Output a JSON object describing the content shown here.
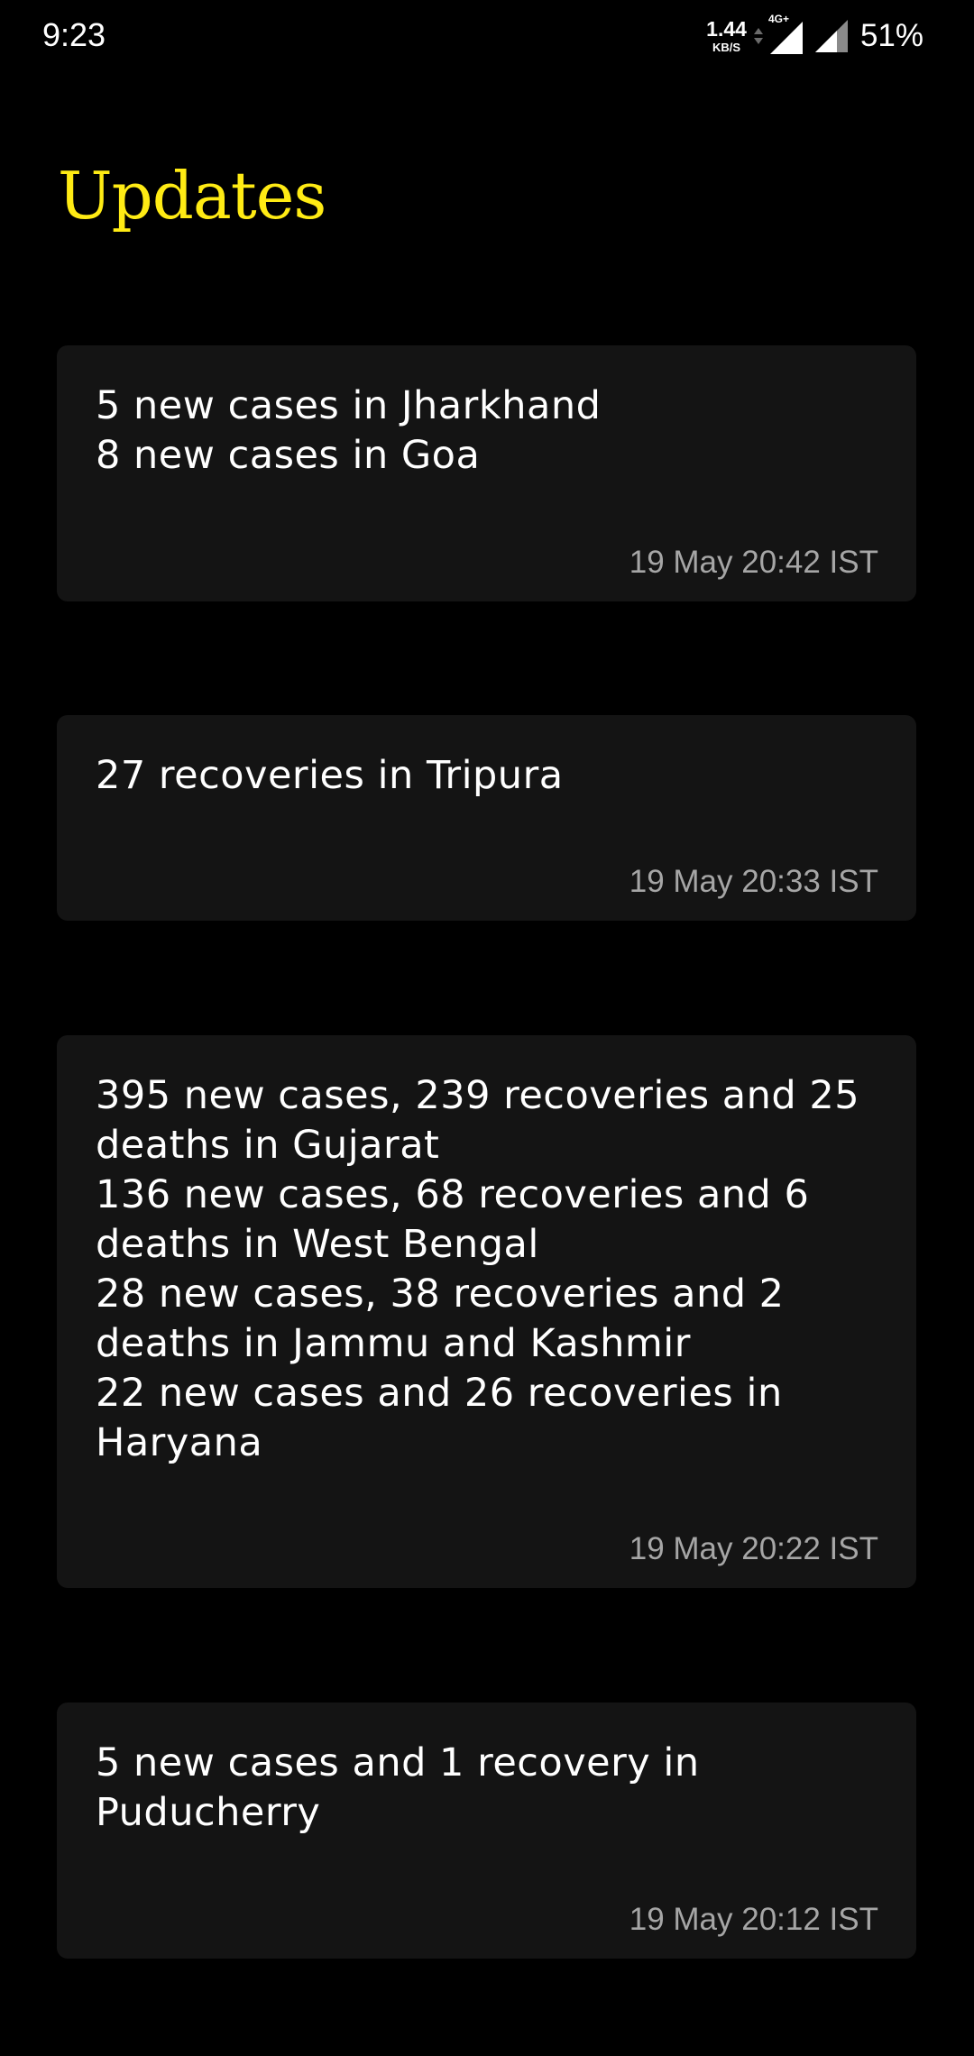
{
  "status_bar": {
    "time": "9:23",
    "net_speed_value": "1.44",
    "net_speed_unit": "KB/S",
    "network_type": "4G+",
    "battery": "51%",
    "icons": [
      "data-arrows-icon",
      "signal-4g-icon",
      "signal-icon"
    ]
  },
  "page": {
    "title": "Updates",
    "title_color": "#ffeb14"
  },
  "updates": [
    {
      "lines": [
        "5 new cases in Jharkhand",
        "8 new cases in Goa"
      ],
      "timestamp": "19 May 20:42 IST"
    },
    {
      "lines": [
        "27 recoveries in Tripura"
      ],
      "timestamp": "19 May 20:33 IST"
    },
    {
      "lines": [
        "395 new cases, 239 recoveries and 25",
        "deaths in Gujarat",
        "136 new cases, 68 recoveries and 6",
        "deaths in West Bengal",
        "28 new cases, 38 recoveries and 2",
        "deaths in Jammu and Kashmir",
        "22 new cases and 26 recoveries in",
        "Haryana"
      ],
      "timestamp": "19 May 20:22 IST"
    },
    {
      "lines": [
        "5 new cases and 1 recovery in",
        "Puducherry"
      ],
      "timestamp": "19 May 20:12 IST"
    }
  ]
}
